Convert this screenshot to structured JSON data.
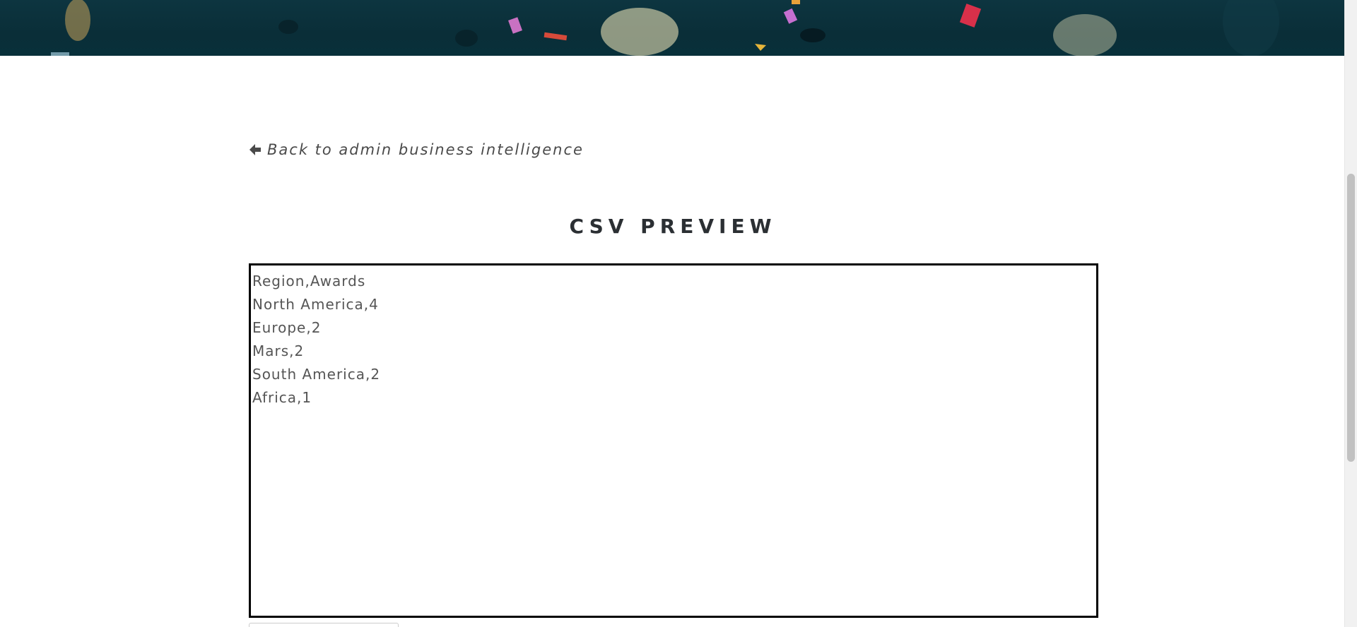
{
  "nav": {
    "back_label": "Back to admin business intelligence",
    "back_icon": "arrow-left-icon"
  },
  "page": {
    "title": "CSV PREVIEW"
  },
  "csv_preview": {
    "lines": [
      "Region,Awards",
      "North America,4",
      "Europe,2",
      "Mars,2",
      "South America,2",
      "Africa,1"
    ]
  },
  "colors": {
    "hero_bg": "#0a2e38",
    "text_dark": "#2b2f33",
    "text_muted": "#555555",
    "border": "#000000"
  }
}
